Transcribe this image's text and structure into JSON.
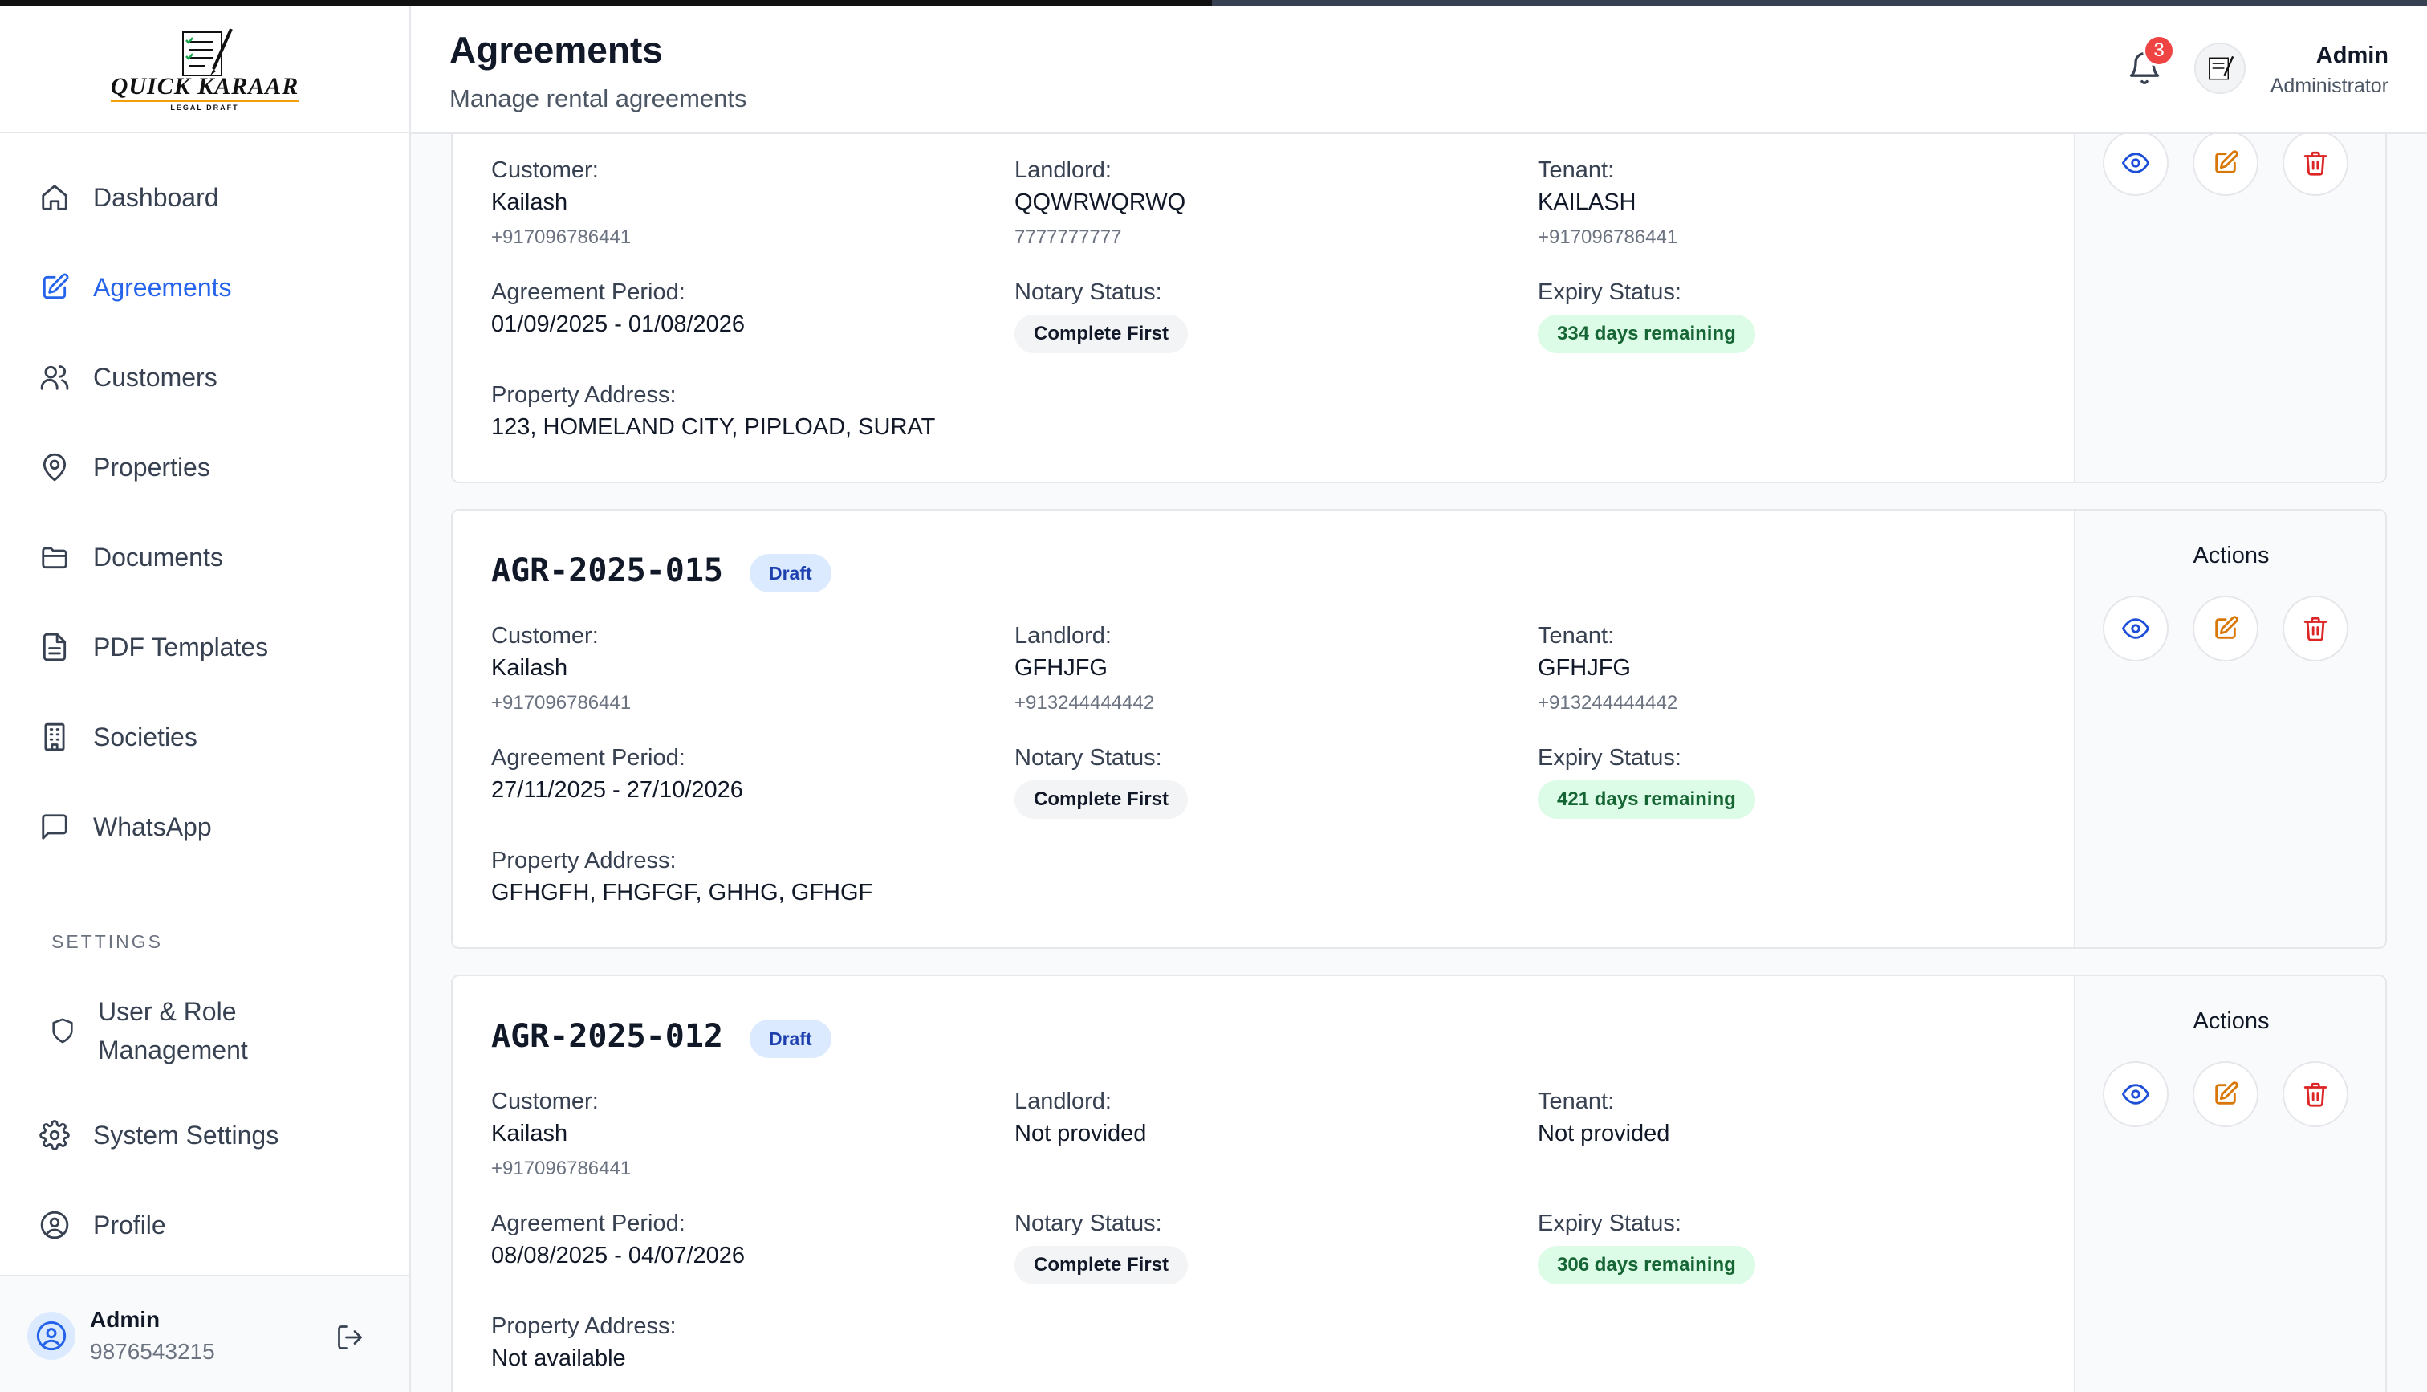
{
  "brand": {
    "name": "QUICK KARAAR",
    "tagline": "LEGAL DRAFT"
  },
  "header": {
    "title": "Agreements",
    "subtitle": "Manage rental agreements",
    "notification_count": "3",
    "user_name": "Admin",
    "user_role": "Administrator"
  },
  "sidebar": {
    "items": [
      {
        "label": "Dashboard",
        "icon": "home-icon"
      },
      {
        "label": "Agreements",
        "icon": "edit-document-icon",
        "active": true
      },
      {
        "label": "Customers",
        "icon": "users-icon"
      },
      {
        "label": "Properties",
        "icon": "map-pin-icon"
      },
      {
        "label": "Documents",
        "icon": "folder-icon"
      },
      {
        "label": "PDF Templates",
        "icon": "file-text-icon"
      },
      {
        "label": "Societies",
        "icon": "building-icon"
      },
      {
        "label": "WhatsApp",
        "icon": "message-icon"
      }
    ],
    "settings_heading": "SETTINGS",
    "settings_items": [
      {
        "label_line1": "User & Role",
        "label_line2": "Management",
        "icon": "shield-icon"
      },
      {
        "label": "System Settings",
        "icon": "gear-icon"
      },
      {
        "label": "Profile",
        "icon": "user-circle-icon"
      }
    ],
    "footer": {
      "name": "Admin",
      "phone": "9876543215"
    }
  },
  "labels": {
    "customer": "Customer:",
    "landlord": "Landlord:",
    "tenant": "Tenant:",
    "agreement_period": "Agreement Period:",
    "notary_status": "Notary Status:",
    "expiry_status": "Expiry Status:",
    "property_address": "Property Address:",
    "actions": "Actions"
  },
  "agreements": [
    {
      "id": "",
      "status": "",
      "customer_name": "Kailash",
      "customer_phone": "+917096786441",
      "landlord_name": "QQWRWQRWQ",
      "landlord_phone": "7777777777",
      "tenant_name": "KAILASH",
      "tenant_phone": "+917096786441",
      "period": "01/09/2025 - 01/08/2026",
      "notary": "Complete First",
      "expiry": "334 days remaining",
      "address": "123, HOMELAND CITY, PIPLOAD, SURAT"
    },
    {
      "id": "AGR-2025-015",
      "status": "Draft",
      "customer_name": "Kailash",
      "customer_phone": "+917096786441",
      "landlord_name": "GFHJFG",
      "landlord_phone": "+913244444442",
      "tenant_name": "GFHJFG",
      "tenant_phone": "+913244444442",
      "period": "27/11/2025 - 27/10/2026",
      "notary": "Complete First",
      "expiry": "421 days remaining",
      "address": "GFHGFH, FHGFGF, GHHG, GFHGF"
    },
    {
      "id": "AGR-2025-012",
      "status": "Draft",
      "customer_name": "Kailash",
      "customer_phone": "+917096786441",
      "landlord_name": "Not provided",
      "landlord_phone": "",
      "tenant_name": "Not provided",
      "tenant_phone": "",
      "period": "08/08/2025 - 04/07/2026",
      "notary": "Complete First",
      "expiry": "306 days remaining",
      "address": "Not available"
    }
  ]
}
